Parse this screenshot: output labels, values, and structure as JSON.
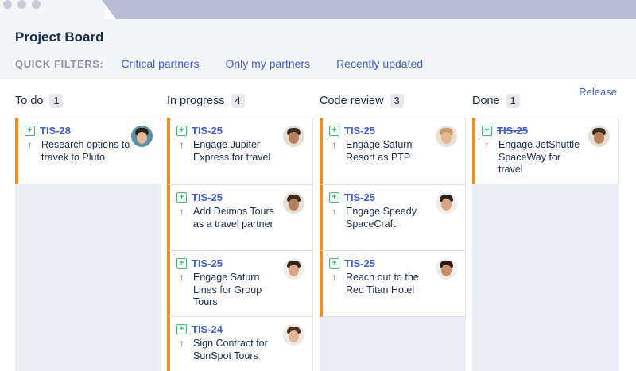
{
  "board": {
    "title": "Project Board"
  },
  "filters": {
    "label": "QUICK FILTERS:",
    "items": [
      "Critical partners",
      "Only my partners",
      "Recently updated"
    ]
  },
  "release_label": "Release",
  "columns": [
    {
      "name": "To do",
      "count": "1",
      "cards": [
        {
          "key": "TIS-28",
          "summary": "Research options to travek to Pluto",
          "avatar": {
            "bg": "#5b8fa3",
            "skin": "#e8b896",
            "hair": "#2b2220"
          }
        }
      ]
    },
    {
      "name": "In progress",
      "count": "4",
      "cards": [
        {
          "key": "TIS-25",
          "summary": "Engage Jupiter Express for travel",
          "avatar": {
            "bg": "#e6ddd3",
            "skin": "#b57f5b",
            "hair": "#3a2a20"
          }
        },
        {
          "key": "TIS-25",
          "summary": "Add Deimos Tours as a travel partner",
          "avatar": {
            "bg": "#e6ddd3",
            "skin": "#b57f5b",
            "hair": "#3a2a20"
          }
        },
        {
          "key": "TIS-25",
          "summary": "Engage Saturn Lines for Group Tours",
          "avatar": {
            "bg": "#f1ece6",
            "skin": "#d9a582",
            "hair": "#2d2320"
          }
        },
        {
          "key": "TIS-24",
          "summary": "Sign Contract for SunSpot Tours",
          "avatar": {
            "bg": "#efe7df",
            "skin": "#e2b595",
            "hair": "#4a3020"
          }
        }
      ]
    },
    {
      "name": "Code review",
      "count": "3",
      "cards": [
        {
          "key": "TIS-25",
          "summary": "Engage Saturn Resort as PTP",
          "avatar": {
            "bg": "#e9e0d6",
            "skin": "#e4b793",
            "hair": "#c79a64"
          }
        },
        {
          "key": "TIS-25",
          "summary": "Engage Speedy SpaceCraft",
          "avatar": {
            "bg": "#f1ece6",
            "skin": "#d9a582",
            "hair": "#2d2320"
          }
        },
        {
          "key": "TIS-25",
          "summary": "Reach out to the Red Titan Hotel",
          "avatar": {
            "bg": "#f3ede7",
            "skin": "#c98d6a",
            "hair": "#2a1d18"
          }
        }
      ]
    },
    {
      "name": "Done",
      "count": "1",
      "cards": [
        {
          "key": "TIS-25",
          "summary": "Engage JetShuttle SpaceWay for travel",
          "done": true,
          "avatar": {
            "bg": "#e6ddd3",
            "skin": "#b57f5b",
            "hair": "#3a2a20"
          }
        }
      ]
    }
  ],
  "icons": {
    "add": "+",
    "priority": "↑"
  }
}
